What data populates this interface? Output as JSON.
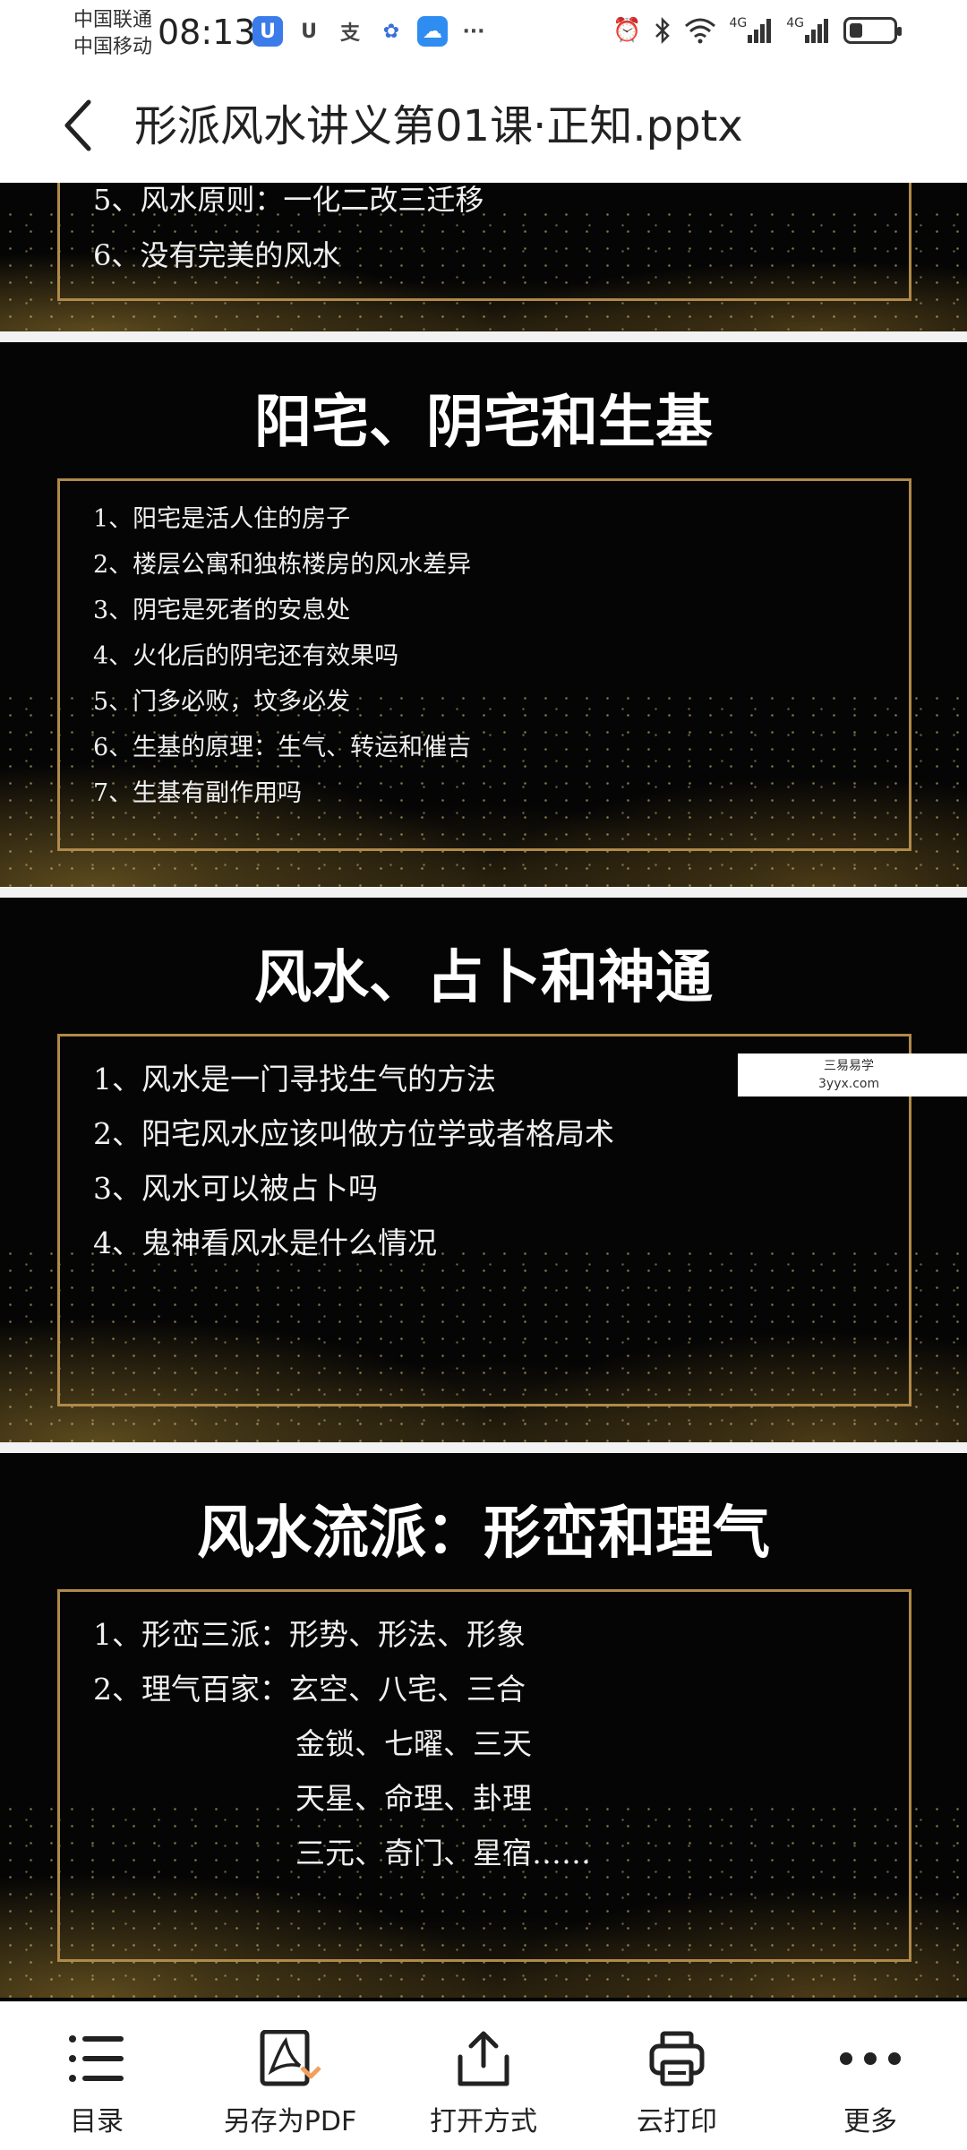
{
  "status_bar": {
    "carrier1": "中国联通",
    "carrier2": "中国移动",
    "time": "08:13",
    "network": "4G"
  },
  "header": {
    "title": "形派风水讲义第01课·正知.pptx"
  },
  "slides": [
    {
      "title": "",
      "items": [
        "5、风水原则：一化二改三迁移",
        "6、没有完美的风水"
      ]
    },
    {
      "title": "阳宅、阴宅和生基",
      "items": [
        "1、阳宅是活人住的房子",
        "2、楼层公寓和独栋楼房的风水差异",
        "3、阴宅是死者的安息处",
        "4、火化后的阴宅还有效果吗",
        "5、门多必败，坟多必发",
        "6、生基的原理：生气、转运和催吉",
        "7、生基有副作用吗"
      ]
    },
    {
      "title": "风水、占卜和神通",
      "items": [
        "1、风水是一门寻找生气的方法",
        "2、阳宅风水应该叫做方位学或者格局术",
        "3、风水可以被占卜吗",
        "4、鬼神看风水是什么情况"
      ]
    },
    {
      "title": "风水流派：形峦和理气",
      "items": [
        "1、形峦三派：形势、形法、形象",
        "2、理气百家：玄空、八宅、三合",
        "金锁、七曜、三天",
        "天星、命理、卦理",
        "三元、奇门、星宿……"
      ]
    }
  ],
  "watermark": {
    "line1": "三易易学",
    "line2": "3yyx.com"
  },
  "toolbar": {
    "items": [
      {
        "label": "目录",
        "icon": "list-icon"
      },
      {
        "label": "另存为PDF",
        "icon": "pdf-icon"
      },
      {
        "label": "打开方式",
        "icon": "share-icon"
      },
      {
        "label": "云打印",
        "icon": "printer-icon"
      },
      {
        "label": "更多",
        "icon": "more-icon"
      }
    ]
  }
}
